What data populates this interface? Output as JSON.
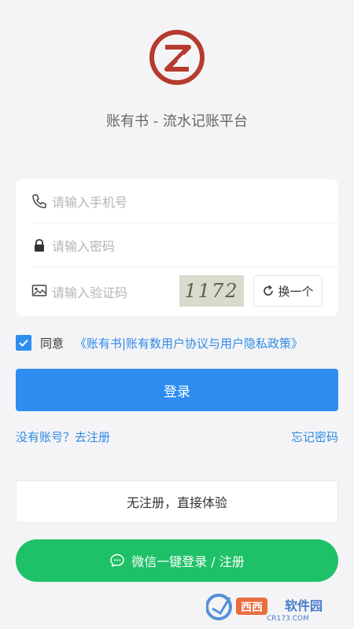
{
  "app": {
    "subtitle": "账有书 - 流水记账平台"
  },
  "form": {
    "phone_placeholder": "请输入手机号",
    "password_placeholder": "请输入密码",
    "captcha_placeholder": "请输入验证码",
    "captcha_code": "1172",
    "refresh_label": "换一个"
  },
  "agreement": {
    "checked": true,
    "prefix": "同意",
    "link": "《账有书|账有数用户协议与用户隐私政策》"
  },
  "actions": {
    "login_label": "登录",
    "register_link": "没有账号？去注册",
    "forgot_link": "忘记密码",
    "trial_label": "无注册，直接体验",
    "wechat_label": "微信一键登录 / 注册"
  },
  "watermark": {
    "brand": "西西软件园",
    "domain": "CR173.COM"
  },
  "colors": {
    "primary": "#2d8cf0",
    "link": "#2e8ae6",
    "wechat": "#1ec167",
    "logo": "#b63a2e",
    "background": "#f4f4f6"
  },
  "icons": [
    "app-logo",
    "phone-icon",
    "lock-icon",
    "image-icon",
    "refresh-icon",
    "check-icon",
    "wechat-icon"
  ]
}
